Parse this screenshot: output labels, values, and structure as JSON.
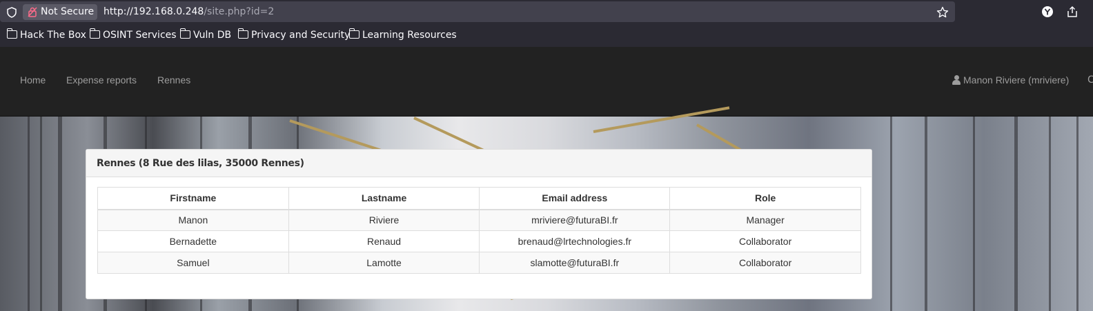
{
  "browser": {
    "security_label": "Not Secure",
    "url_host": "http://192.168.0.248",
    "url_path": "/site.php?id=2",
    "bookmarks": [
      "Hack The Box",
      "OSINT Services",
      "Vuln DB",
      "Privacy and Security",
      "Learning Resources"
    ],
    "icons": [
      "shield-icon",
      "lock-icon",
      "star-icon",
      "extension-y-icon",
      "share-icon"
    ]
  },
  "navbar": {
    "links": [
      "Home",
      "Expense reports",
      "Rennes"
    ],
    "user": "Manon Riviere (mriviere)",
    "edge_glyph": "C"
  },
  "panel": {
    "title": "Rennes (8 Rue des lilas, 35000 Rennes)",
    "columns": [
      "Firstname",
      "Lastname",
      "Email address",
      "Role"
    ],
    "rows": [
      [
        "Manon",
        "Riviere",
        "mriviere@futuraBI.fr",
        "Manager"
      ],
      [
        "Bernadette",
        "Renaud",
        "brenaud@lrtechnologies.fr",
        "Collaborator"
      ],
      [
        "Samuel",
        "Lamotte",
        "slamotte@futuraBI.fr",
        "Collaborator"
      ]
    ]
  }
}
